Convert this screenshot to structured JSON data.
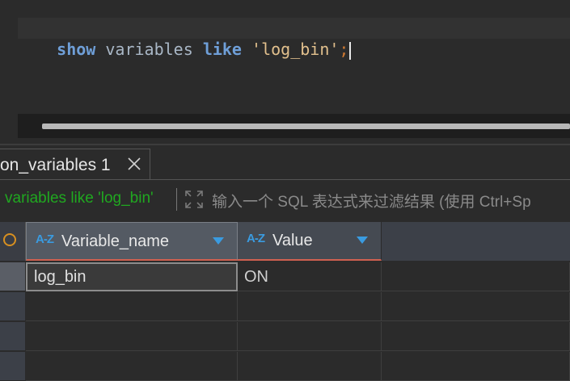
{
  "editor": {
    "tokens": [
      {
        "text": "show",
        "kind": "kw"
      },
      {
        "text": " ",
        "kind": "id"
      },
      {
        "text": "variables",
        "kind": "id"
      },
      {
        "text": " ",
        "kind": "id"
      },
      {
        "text": "like",
        "kind": "kw"
      },
      {
        "text": " ",
        "kind": "id"
      },
      {
        "text": "'log_bin'",
        "kind": "str"
      },
      {
        "text": ";",
        "kind": "punct"
      }
    ]
  },
  "result_tab": {
    "label": "on_variables 1"
  },
  "filter": {
    "query_text": "variables like 'log_bin'",
    "placeholder": "输入一个 SQL 表达式来过滤结果 (使用 Ctrl+Sp"
  },
  "grid": {
    "sort_glyph": "A-Z",
    "columns": [
      "Variable_name",
      "Value"
    ],
    "rows": [
      [
        "log_bin",
        "ON"
      ],
      [
        "",
        ""
      ],
      [
        "",
        ""
      ],
      [
        "",
        ""
      ]
    ]
  },
  "colors": {
    "keyword": "#6f9fd8",
    "string": "#e2c08d",
    "filter_text": "#20a820",
    "sort_icon": "#3a9be0",
    "header_underline": "#d06050"
  }
}
